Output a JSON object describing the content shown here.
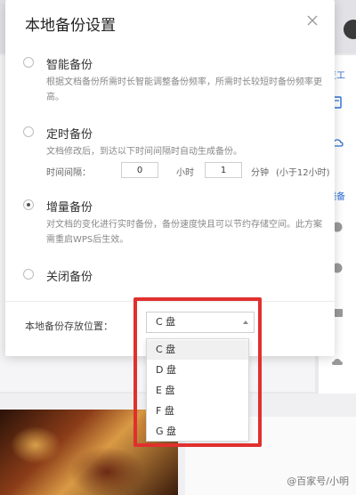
{
  "dialog": {
    "title": "本地备份设置",
    "options": [
      {
        "label": "智能备份",
        "checked": false,
        "desc": "根据文档备份所需时长智能调整备份频率，所需时长较短时备份频率更高。"
      },
      {
        "label": "定时备份",
        "checked": false,
        "desc": "文档修改后，到达以下时间间隔时自动生成备份。",
        "interval": {
          "prefix": "时间间隔：",
          "hours_value": "0",
          "hours_unit": "小时",
          "minutes_value": "1",
          "minutes_unit": "分钟",
          "note": "(小于12小时)"
        }
      },
      {
        "label": "增量备份",
        "checked": true,
        "desc": "对文档的变化进行实时备份，备份速度快且可以节约存储空间。此方案需重启WPS后生效。"
      },
      {
        "label": "关闭备份",
        "checked": false
      }
    ],
    "location": {
      "label": "本地备份存放位置：",
      "selected": "C 盘",
      "choices": [
        "C 盘",
        "D 盘",
        "E 盘",
        "F 盘",
        "G 盘"
      ]
    }
  },
  "background": {
    "right_items": [
      "复工",
      "端备"
    ],
    "watermark": "@百家号/小明"
  },
  "colors": {
    "highlight": "#e0302e",
    "link": "#2b6fd6"
  }
}
